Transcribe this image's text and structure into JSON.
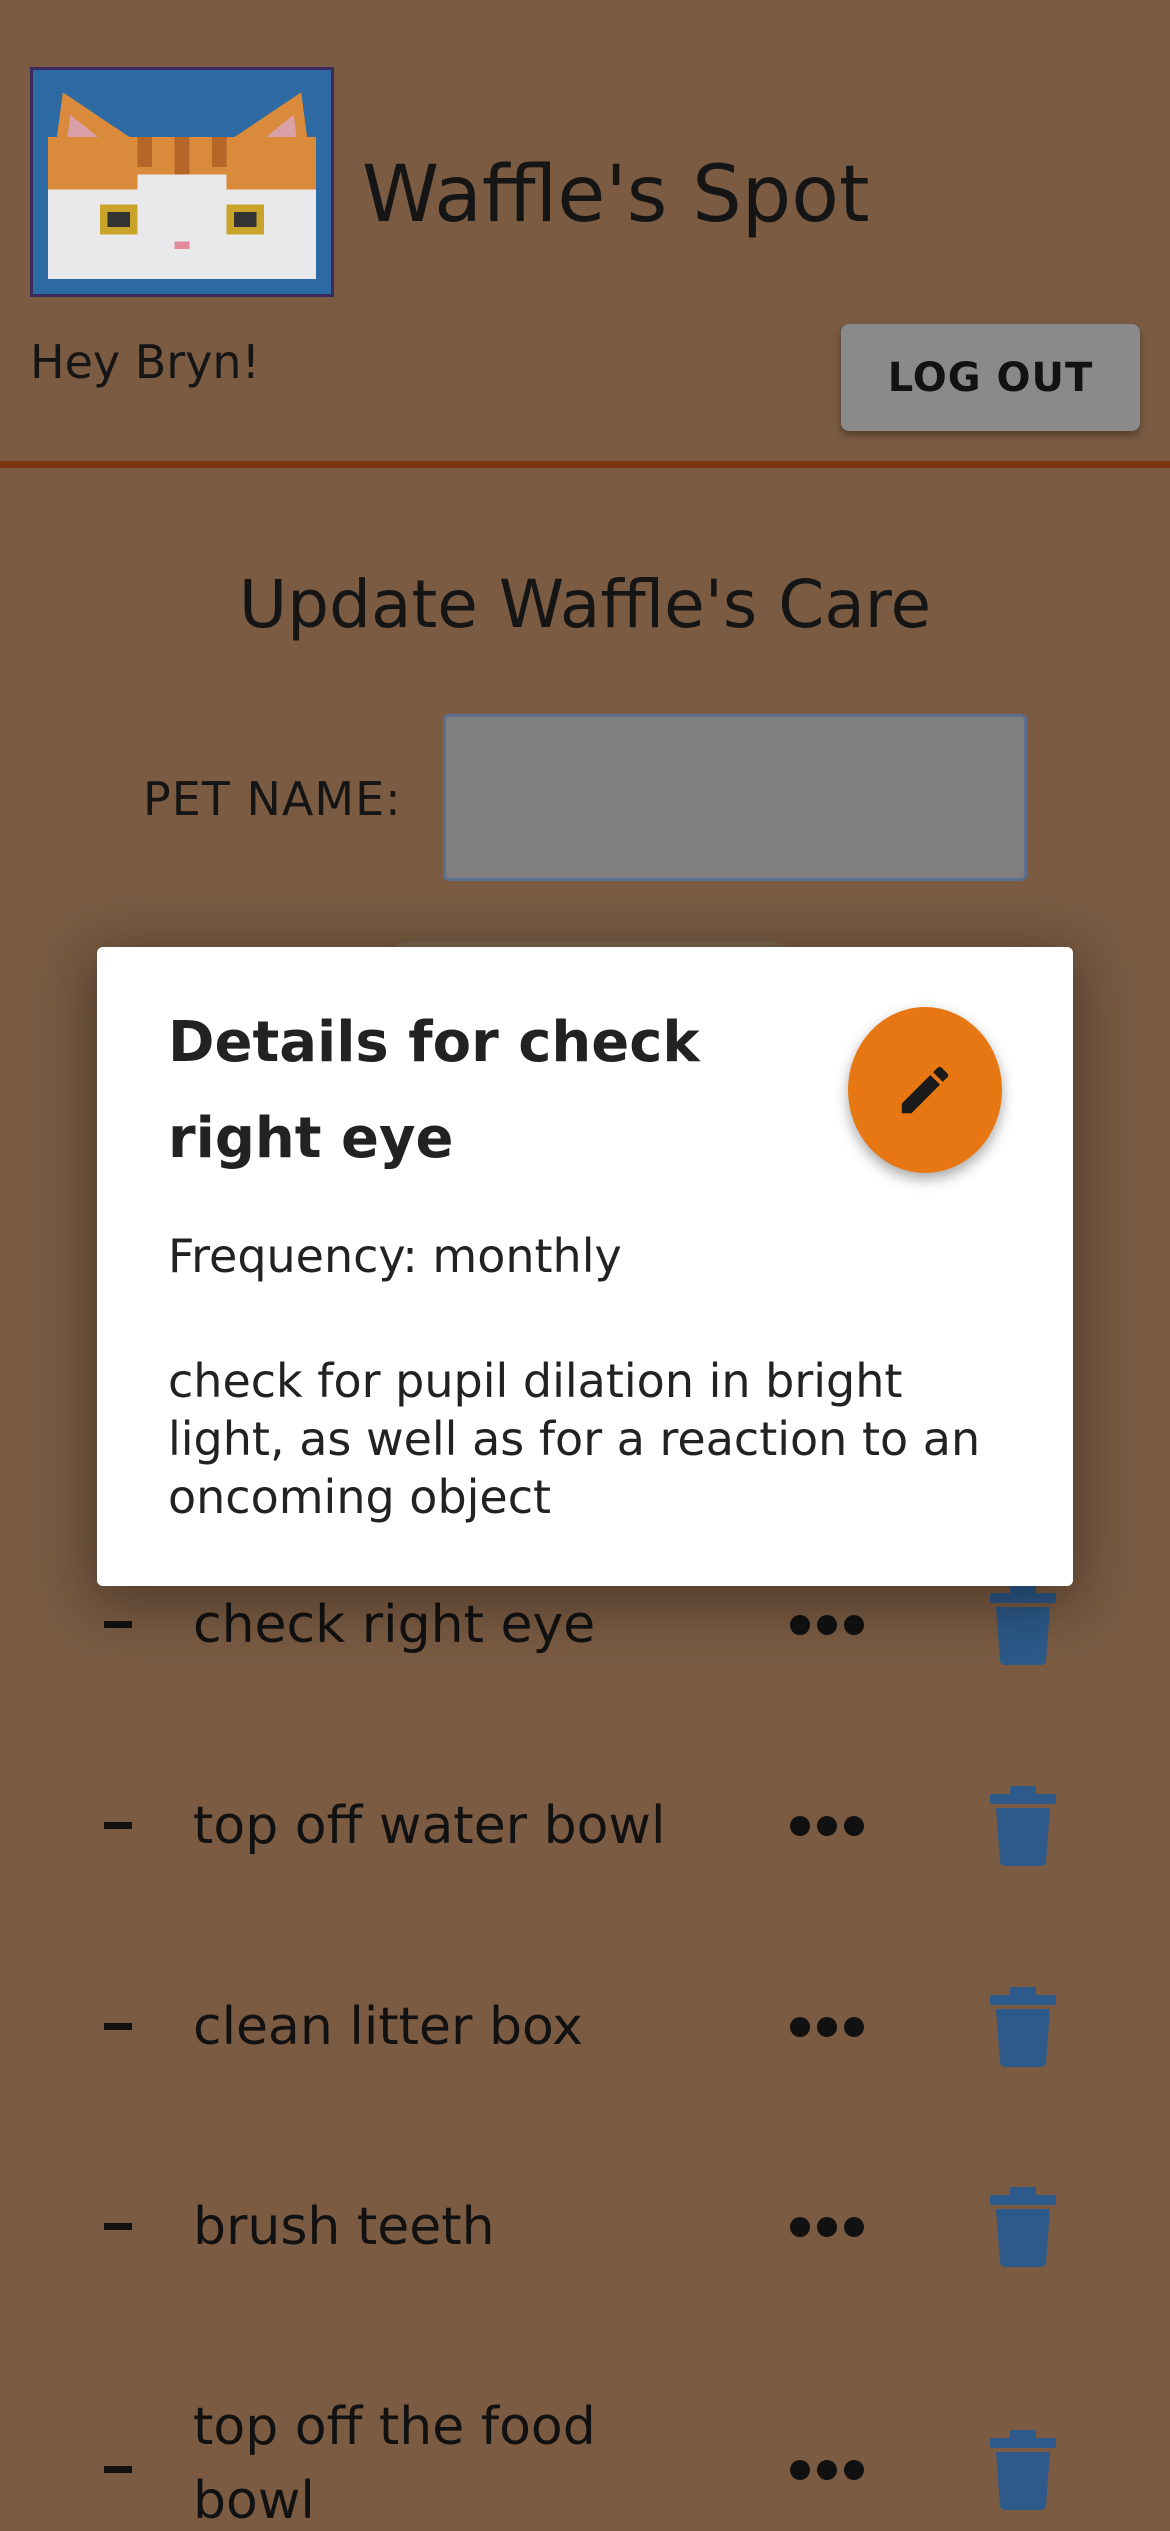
{
  "header": {
    "app_title": "Waffle's Spot",
    "greeting": "Hey Bryn!",
    "logout_label": "LOG OUT",
    "logo_icon": "cat-face-pixel-icon"
  },
  "form": {
    "section_title": "Update Waffle's Care",
    "pet_name_label": "PET NAME:",
    "pet_name_value": ""
  },
  "tasks": [
    {
      "label": "check right eye"
    },
    {
      "label": "top off water bowl"
    },
    {
      "label": "clean litter box"
    },
    {
      "label": "brush teeth"
    },
    {
      "label": "top off the food bowl"
    }
  ],
  "dialog": {
    "title": "Details for check right eye",
    "frequency": "Frequency: monthly",
    "description": "check for pupil dilation in bright light, as well as for a reaction to an oncoming object",
    "edit_icon": "pencil-icon"
  },
  "colors": {
    "background": "#7b5c43",
    "accent_orange": "#e77713",
    "trash_blue": "#2d5a8a",
    "divider": "#7a3510"
  }
}
